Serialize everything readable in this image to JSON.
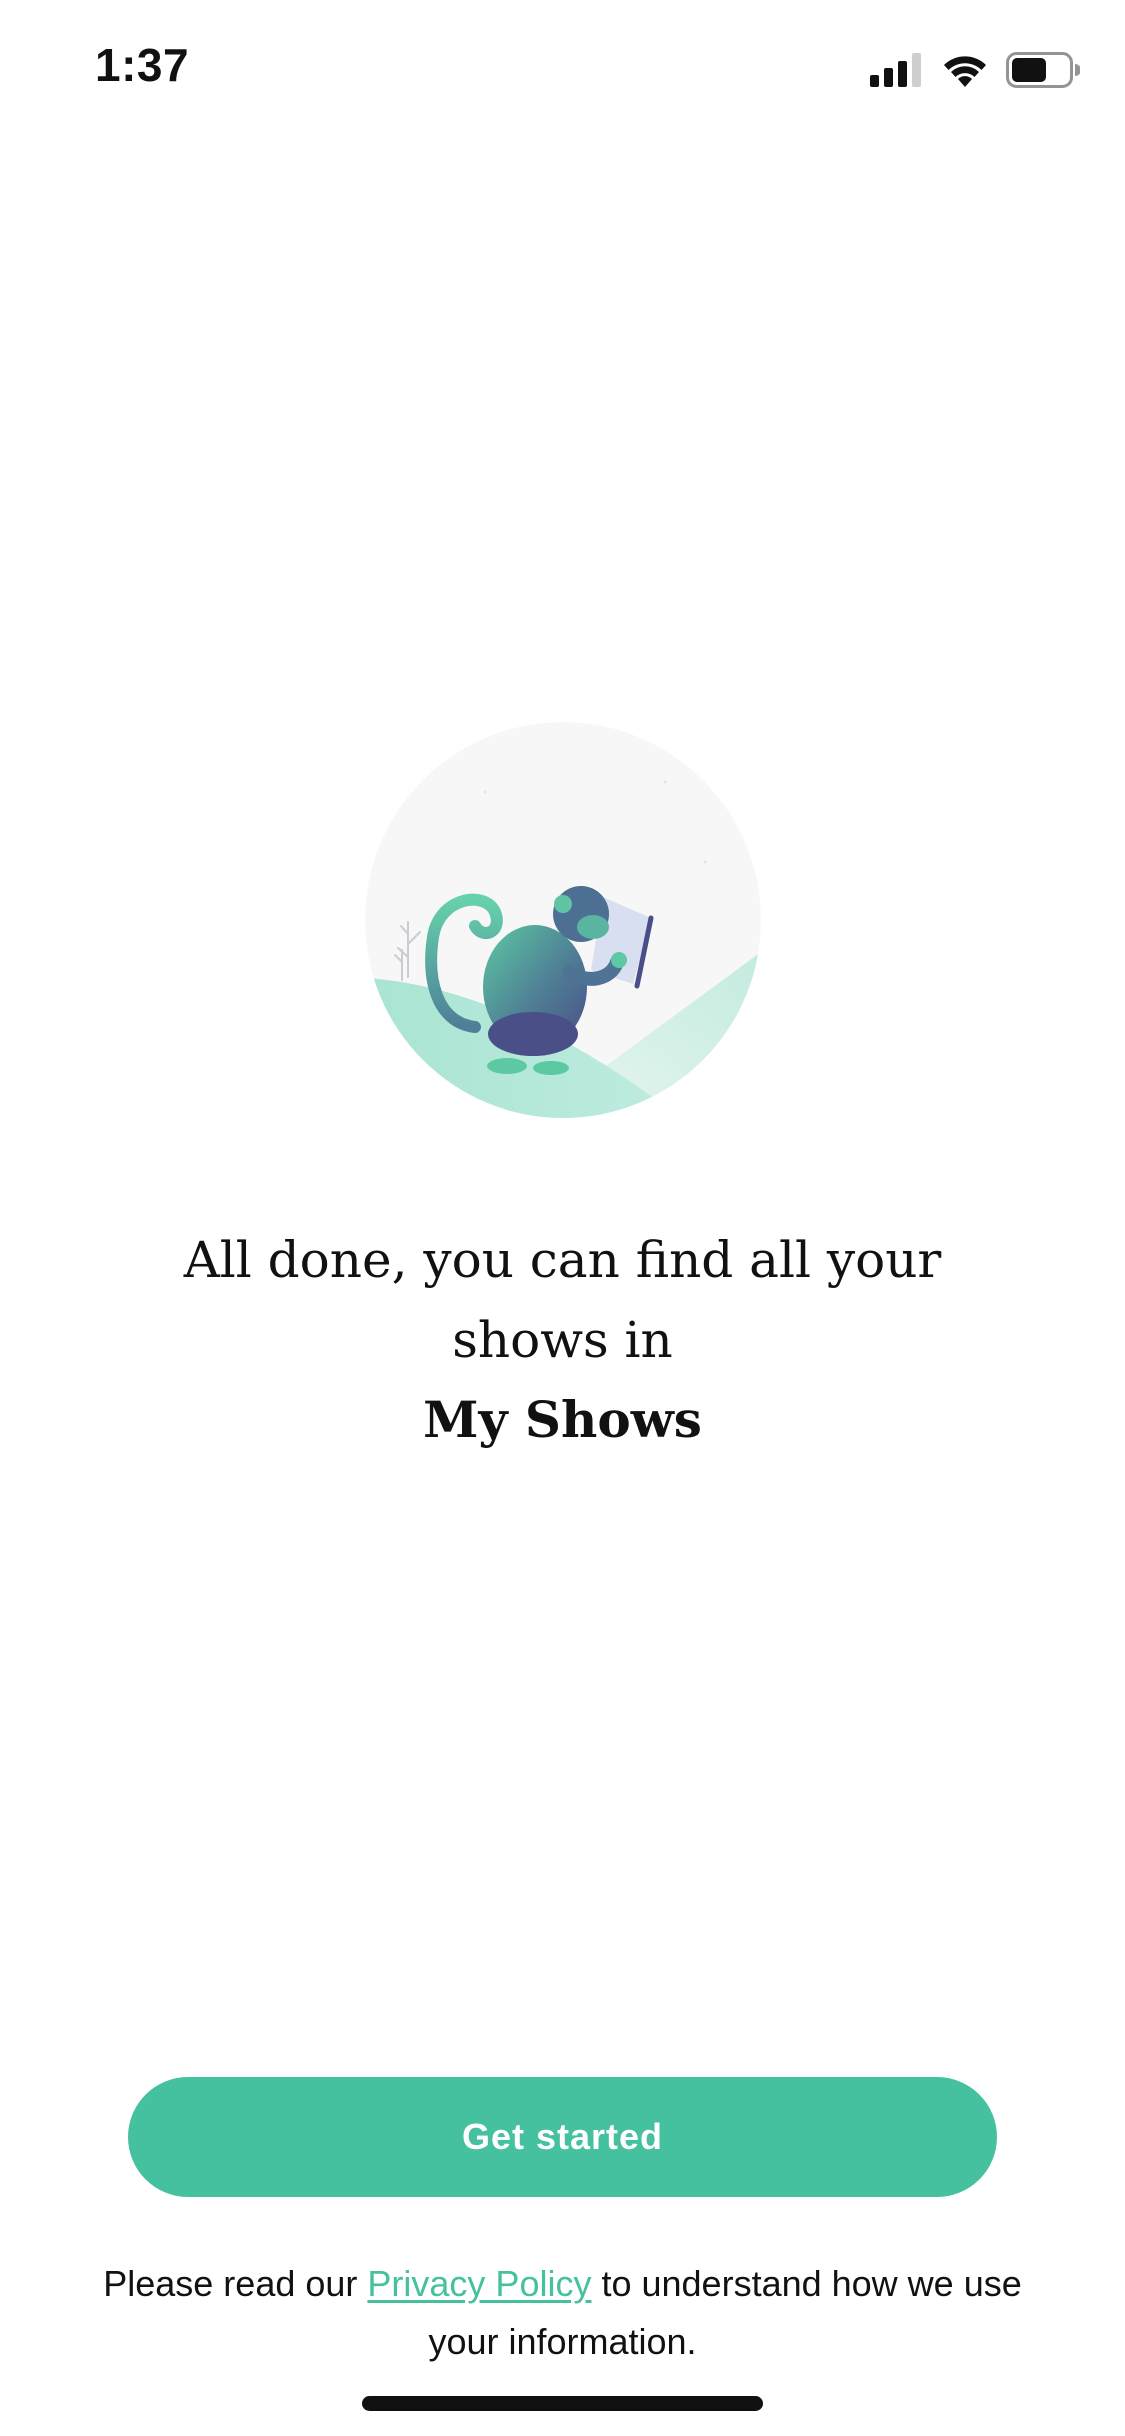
{
  "status_bar": {
    "time": "1:37",
    "icons": [
      "cellular-signal-icon",
      "wifi-icon",
      "battery-icon"
    ],
    "battery_level": 0.55
  },
  "hero": {
    "illustration": "monkey-reading-tablet-illustration"
  },
  "message": {
    "text": "All done, you can find all your shows in",
    "emphasis": "My Shows"
  },
  "cta": {
    "label": "Get started"
  },
  "privacy": {
    "prefix": "Please read our ",
    "link_label": "Privacy Policy",
    "suffix": " to understand how we use your information."
  },
  "colors": {
    "accent": "#45c19f",
    "text": "#111111",
    "background": "#ffffff",
    "hero_circle": "#f7f7f7",
    "hill": "#a9e4d3"
  }
}
